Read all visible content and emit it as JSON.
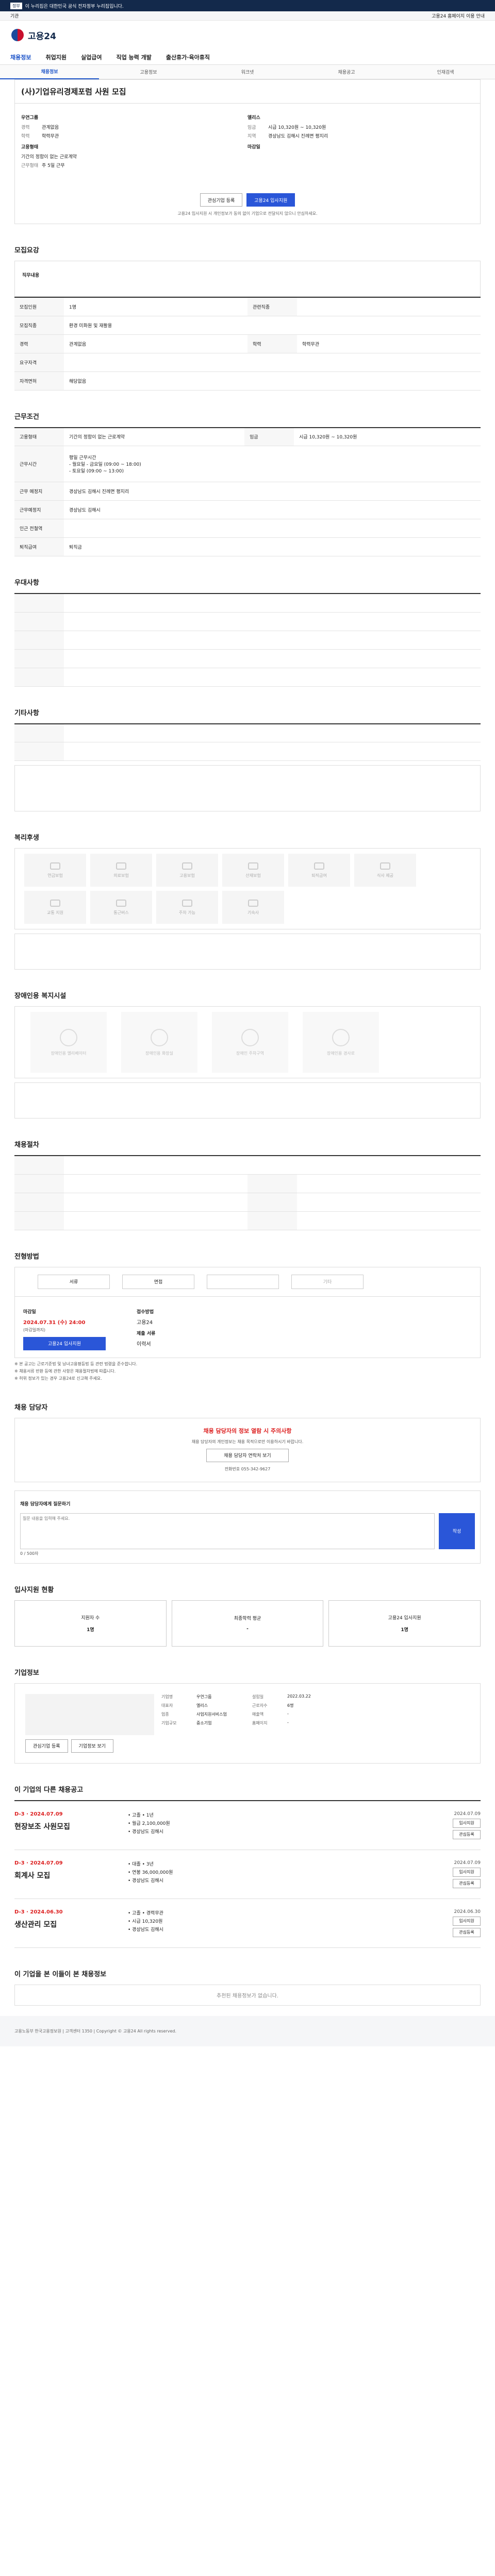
{
  "nav": {
    "notice_tag": "정부",
    "notice_text": "이 누리집은 대한민국 공식 전자정부 누리집입니다.",
    "gov_label": "기관",
    "user_link": "고용24 홈페이지 이용 안내",
    "brand": "고용24",
    "menu": [
      "채용정보",
      "취업지원",
      "실업급여",
      "직업 능력 개발",
      "출산휴가·육아휴직"
    ],
    "sub_menu": [
      "채용정보",
      "고용정보",
      "워크넷",
      "채용공고",
      "인재검색"
    ]
  },
  "title": "(사)기업유리경제포럼 사원 모집",
  "post": {
    "company": "우연그룹",
    "ceo": "엘리스",
    "career_label": "경력",
    "career": "관계없음",
    "edu_label": "학력",
    "edu": "학력무관",
    "pay_label": "임금",
    "pay": "시급 10,320원 ~ 10,320원",
    "loc_label": "지역",
    "loc": "경상남도 김해시 진례면 평지리",
    "emp_label": "고용형태",
    "emp": "기간의 정함이 없는 근로계약",
    "hours_label": "근무형태",
    "hours": "주 5일 근무",
    "closing_label": "마감일",
    "btn_interest": "관심기업 등록",
    "btn_apply": "고용24 입사지원",
    "note": "고용24 입사지원 시 개인정보가 동의 없이 기업으로 전달되지 않으니 안심하세요."
  },
  "section_titles": {
    "recruit": "모집요강",
    "work": "근무조건",
    "prefer": "우대사항",
    "etc": "기타사항",
    "welfare": "복리후생",
    "disability": "장애인용 복지시설",
    "company": "채용절차",
    "howto": "전형방법",
    "manager": "채용 담당자",
    "stats": "입사지원 현황",
    "biz": "기업정보",
    "others": "이 기업의 다른 채용공고",
    "recommend": "이 기업을 본 이들이 본 채용정보"
  },
  "recruit_rows": [
    [
      "직무내용",
      ""
    ],
    [
      "모집인원",
      "1명"
    ],
    [
      "모집직종",
      "환경 미화원 및 재활용"
    ],
    [
      "관련직종",
      ""
    ],
    [
      "경력",
      "관계없음"
    ],
    [
      "학력",
      "학력무관"
    ],
    [
      "요구자격",
      ""
    ],
    [
      "자격면허",
      "해당없음"
    ]
  ],
  "work_rows": [
    [
      "고용형태",
      "기간의 정함이 없는 근로계약"
    ],
    [
      "근무시간",
      "평일 근무시간\n- 월요일 - 금요일 (09:00 ~ 18:00)\n- 토요일 (09:00 ~ 13:00)"
    ],
    [
      "근무 예정지",
      "경상남도 김해시 진례면 평지리"
    ],
    [
      "근무예정지",
      "경상남도 김해시"
    ],
    [
      "인근 전철역",
      ""
    ],
    [
      "퇴직급여",
      "퇴직금"
    ]
  ],
  "welfare_items": [
    "연금보험",
    "의료보험",
    "고용보험",
    "산재보험",
    "퇴직급여",
    "식사 제공",
    "교통 지원",
    "통근버스",
    "주차 가능",
    "기숙사"
  ],
  "disability_items": [
    "장애인용 엘리베이터",
    "장애인용 화장실",
    "장애인 주차구역",
    "장애인용 경사로"
  ],
  "howto": {
    "methods": [
      "서류",
      "면접",
      "",
      "기타"
    ],
    "deadline_label": "마감일",
    "deadline": "2024.07.31 (수) 24:00",
    "deadline_note": "(마감일까지)",
    "apply_label": "접수방법",
    "apply_value": "고용24",
    "btn": "고용24 입사지원",
    "docs_label": "제출 서류",
    "docs": "이력서",
    "notes": [
      "※ 본 공고는 근로기준법 및 남녀고용평등법 등 관련 법령을 준수합니다.",
      "※ 채용서류 반환 등에 관한 사항은 채용절차법에 따릅니다.",
      "※ 허위 정보가 있는 경우 고용24로 신고해 주세요."
    ]
  },
  "manager": {
    "alert": "채용 담당자의 정보 열람 시 주의사항",
    "alert_body": "채용 담당자의 개인정보는 채용 목적으로만 이용하시기 바랍니다.",
    "btn": "채용 담당자 연락처 보기",
    "tel_label": "전화번호",
    "tel": "055-342-9627"
  },
  "inquiry": {
    "label": "채용 담당자에게 질문하기",
    "placeholder": "질문 내용을 입력해 주세요.",
    "count": "0 / 500자",
    "btn": "작성"
  },
  "stats": {
    "label": "지원자",
    "value": "1명",
    "cards": [
      [
        "지원자 수",
        "1명"
      ],
      [
        "최종학력 평균",
        "-"
      ],
      [
        "고용24 입사지원",
        "1명"
      ]
    ]
  },
  "biz": {
    "rows": [
      [
        "기업명",
        "우연그룹"
      ],
      [
        "대표자",
        "엘리스"
      ],
      [
        "업종",
        "사업지원서비스업"
      ],
      [
        "기업규모",
        "중소기업"
      ],
      [
        "설립일",
        "2022.03.22"
      ],
      [
        "근로자수",
        "6명"
      ],
      [
        "매출액",
        "-"
      ],
      [
        "홈페이지",
        "-"
      ]
    ],
    "btn1": "관심기업 등록",
    "btn2": "기업정보 보기"
  },
  "others": [
    {
      "dday": "D-3 · 2024.07.09",
      "name": "현장보조 사원모집",
      "info": [
        "• 고졸 • 1년",
        "• 월급 2,100,000원",
        "• 경상남도 김해시"
      ],
      "date": "2024.07.09",
      "b1": "입사지원",
      "b2": "관심등록"
    },
    {
      "dday": "D-3 · 2024.07.09",
      "name": "회계사 모집",
      "info": [
        "• 대졸 • 3년",
        "• 연봉 36,000,000원",
        "• 경상남도 김해시"
      ],
      "date": "2024.07.09",
      "b1": "입사지원",
      "b2": "관심등록"
    },
    {
      "dday": "D-3 · 2024.06.30",
      "name": "생산관리 모집",
      "info": [
        "• 고졸 • 경력무관",
        "• 시급 10,320원",
        "• 경상남도 김해시"
      ],
      "date": "2024.06.30",
      "b1": "입사지원",
      "b2": "관심등록"
    }
  ],
  "recommend_empty": "추천된 채용정보가 없습니다.",
  "footer": "고용노동부 한국고용정보원 | 고객센터 1350 | Copyright © 고용24 All rights reserved."
}
